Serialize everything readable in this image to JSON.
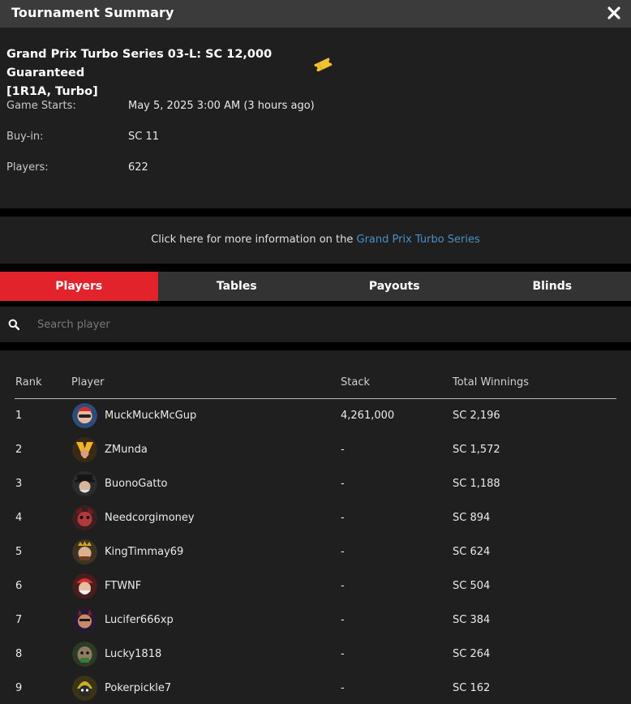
{
  "window": {
    "title": "Tournament Summary",
    "close_icon": "close-icon"
  },
  "tournament": {
    "name_line1": "Grand Prix Turbo Series 03-L: SC 12,000 Guaranteed",
    "name_line2": "[1R1A, Turbo]",
    "ticket_icon": "ticket-icon",
    "details": [
      {
        "label": "Game Starts:",
        "value": "May 5, 2025 3:00 AM (3 hours ago)"
      },
      {
        "label": "Buy-in:",
        "value": "SC 11"
      },
      {
        "label": "Players:",
        "value": "622"
      }
    ]
  },
  "more_info": {
    "text": "Click here for more information on the ",
    "link": "Grand Prix Turbo Series"
  },
  "tabs": [
    {
      "label": "Players",
      "active": true
    },
    {
      "label": "Tables",
      "active": false
    },
    {
      "label": "Payouts",
      "active": false
    },
    {
      "label": "Blinds",
      "active": false
    }
  ],
  "search": {
    "placeholder": "Search player",
    "value": "",
    "icon": "search-icon"
  },
  "table": {
    "headers": {
      "rank": "Rank",
      "player": "Player",
      "stack": "Stack",
      "winnings": "Total Winnings"
    },
    "rows": [
      {
        "rank": "1",
        "player": "MuckMuckMcGup",
        "stack": "4,261,000",
        "winnings": "SC 2,196"
      },
      {
        "rank": "2",
        "player": "ZMunda",
        "stack": "-",
        "winnings": "SC 1,572"
      },
      {
        "rank": "3",
        "player": "BuonoGatto",
        "stack": "-",
        "winnings": "SC 1,188"
      },
      {
        "rank": "4",
        "player": "Needcorgimoney",
        "stack": "-",
        "winnings": "SC 894"
      },
      {
        "rank": "5",
        "player": "KingTimmay69",
        "stack": "-",
        "winnings": "SC 624"
      },
      {
        "rank": "6",
        "player": "FTWNF",
        "stack": "-",
        "winnings": "SC 504"
      },
      {
        "rank": "7",
        "player": "Lucifer666xp",
        "stack": "-",
        "winnings": "SC 384"
      },
      {
        "rank": "8",
        "player": "Lucky1818",
        "stack": "-",
        "winnings": "SC 264"
      },
      {
        "rank": "9",
        "player": "Pokerpickle7",
        "stack": "-",
        "winnings": "SC 162"
      }
    ]
  },
  "colors": {
    "accent": "#e3232c",
    "link": "#4a90c8",
    "panel": "#1f1f1f",
    "titlebar": "#3b3b3b",
    "tabbar": "#333333",
    "ticket": "#f2c230"
  }
}
